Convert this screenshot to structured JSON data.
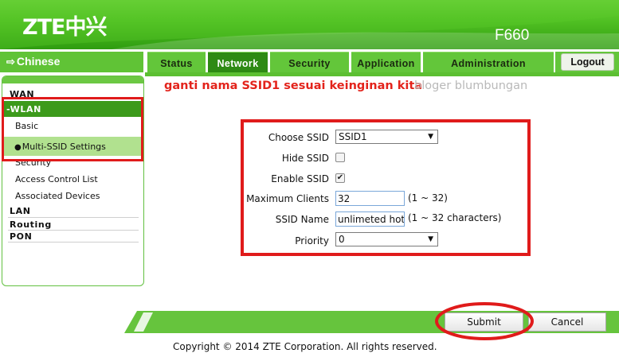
{
  "header": {
    "logo": "ZTE中兴",
    "model": "F660"
  },
  "language": {
    "arrow": "⇨",
    "label": "Chinese"
  },
  "tabs": [
    {
      "label": "Status"
    },
    {
      "label": "Network"
    },
    {
      "label": "Security"
    },
    {
      "label": "Application"
    },
    {
      "label": "Administration"
    }
  ],
  "logout_label": "Logout",
  "sidebar": {
    "wan": "WAN",
    "wlan": "-WLAN",
    "basic": "Basic",
    "multi_ssid": "Multi-SSID Settings",
    "security": "Security",
    "acl": "Access Control List",
    "associated": "Associated Devices",
    "lan": "LAN",
    "routing": "Routing",
    "pon": "PON"
  },
  "annotation": {
    "instruction": "ganti nama SSID1 sesuai keinginan kita",
    "blog": "bloger blumbungan"
  },
  "form": {
    "choose_ssid_label": "Choose SSID",
    "choose_ssid_value": "SSID1",
    "hide_ssid_label": "Hide SSID",
    "hide_ssid_checked": false,
    "enable_ssid_label": "Enable SSID",
    "enable_ssid_checked": true,
    "max_clients_label": "Maximum Clients",
    "max_clients_value": "32",
    "max_clients_hint": "(1 ~ 32)",
    "ssid_name_label": "SSID Name",
    "ssid_name_value": "unlimeted hot",
    "ssid_name_hint": "(1 ~ 32 characters)",
    "priority_label": "Priority",
    "priority_value": "0"
  },
  "buttons": {
    "submit": "Submit",
    "cancel": "Cancel"
  },
  "footer": {
    "copyright": "Copyright © 2014 ZTE Corporation. All rights reserved."
  },
  "colors": {
    "brand_green": "#4fbf22",
    "active_tab": "#2e8a14",
    "annotation_red": "#e01b1b"
  }
}
